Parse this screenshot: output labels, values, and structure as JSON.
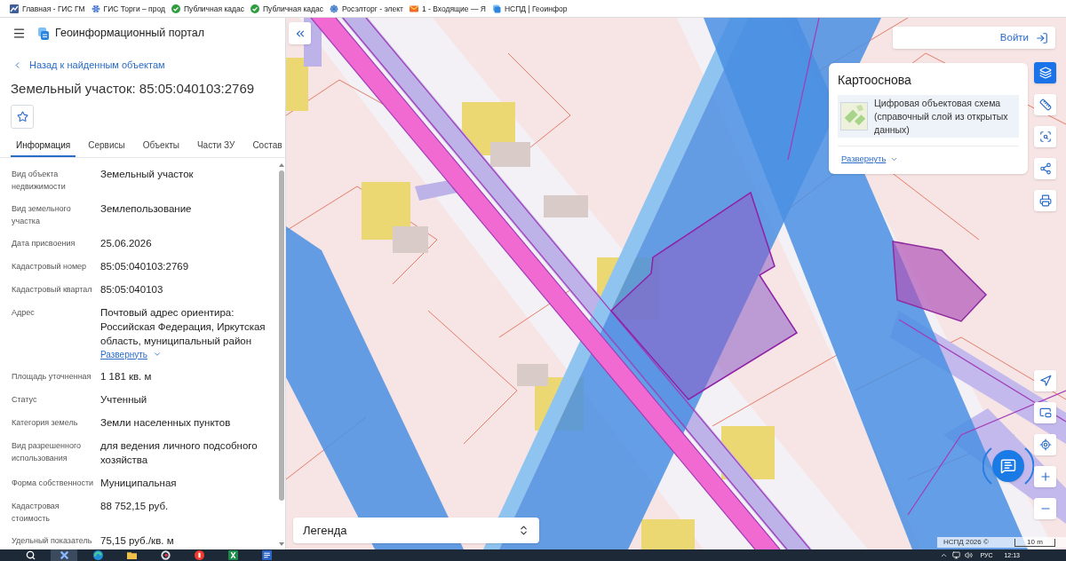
{
  "bookmarks": [
    {
      "label": "Главная - ГИС ГМ"
    },
    {
      "label": "ГИС Торги – прод"
    },
    {
      "label": "Публичная кадас"
    },
    {
      "label": "Публичная кадас"
    },
    {
      "label": "Росэлторг - элект"
    },
    {
      "label": "1 - Входящие — Я"
    },
    {
      "label": "НСПД | Геоинфор"
    }
  ],
  "header": {
    "title": "Геоинформационный портал"
  },
  "object_card": {
    "back_link": "Назад к найденным объектам",
    "title": "Земельный участок: 85:05:040103:2769",
    "favorite": false,
    "tabs": [
      {
        "label": "Информация",
        "selected": true
      },
      {
        "label": "Сервисы",
        "selected": false
      },
      {
        "label": "Объекты",
        "selected": false
      },
      {
        "label": "Части ЗУ",
        "selected": false
      },
      {
        "label": "Состав",
        "selected": false
      }
    ],
    "rows": [
      {
        "label": "Вид объекта недвижимости",
        "value": "Земельный участок"
      },
      {
        "label": "Вид земельного участка",
        "value": "Землепользование"
      },
      {
        "label": "Дата присвоения",
        "value": "25.06.2026"
      },
      {
        "label": "Кадастровый номер",
        "value": "85:05:040103:2769"
      },
      {
        "label": "Кадастровый квартал",
        "value": "85:05:040103"
      },
      {
        "label": "Адрес",
        "value": "Почтовый адрес ориентира: Российская Федерация, Иркутская область, муниципальный район",
        "expand_link": "Развернуть"
      },
      {
        "label": "Площадь уточненная",
        "value": "1 181 кв. м"
      },
      {
        "label": "Статус",
        "value": "Учтенный"
      },
      {
        "label": "Категория земель",
        "value": "Земли населенных пунктов"
      },
      {
        "label": "Вид разрешенного использования",
        "value": "для ведения личного подсобного хозяйства"
      },
      {
        "label": "Форма собственности",
        "value": "Муниципальная"
      },
      {
        "label": "Кадастровая стоимость",
        "value": "88 752,15 руб."
      },
      {
        "label": "Удельный показатель",
        "value": "75,15 руб./кв. м"
      }
    ]
  },
  "map": {
    "login_button": "Войти",
    "basemap": {
      "title": "Картооснова",
      "layer": "Цифровая объектовая схема (справочный слой из открытых данных)",
      "expand_link": "Развернуть"
    },
    "tools": [
      {
        "kind": "layers",
        "selected": true
      },
      {
        "kind": "ruler",
        "selected": false
      },
      {
        "kind": "select",
        "selected": false
      },
      {
        "kind": "share",
        "selected": false
      },
      {
        "kind": "print",
        "selected": false
      }
    ],
    "nav_tools": [
      {
        "kind": "locate"
      },
      {
        "kind": "minimap"
      },
      {
        "kind": "target"
      },
      {
        "kind": "zoom_in"
      },
      {
        "kind": "zoom_out"
      }
    ],
    "legend": {
      "title": "Легенда"
    },
    "attribution": "НСПД 2026 ©",
    "scale": "10 m"
  },
  "taskbar": {
    "apps": [
      {
        "kind": "search",
        "selected": false
      },
      {
        "kind": "cross",
        "selected": true
      },
      {
        "kind": "swirl",
        "selected": false
      },
      {
        "kind": "folder",
        "selected": false
      },
      {
        "kind": "ring",
        "selected": false
      },
      {
        "kind": "disc",
        "selected": false
      },
      {
        "kind": "sheet",
        "selected": false
      },
      {
        "kind": "doc",
        "selected": false
      }
    ],
    "language": "РУС",
    "time": "12:13"
  }
}
